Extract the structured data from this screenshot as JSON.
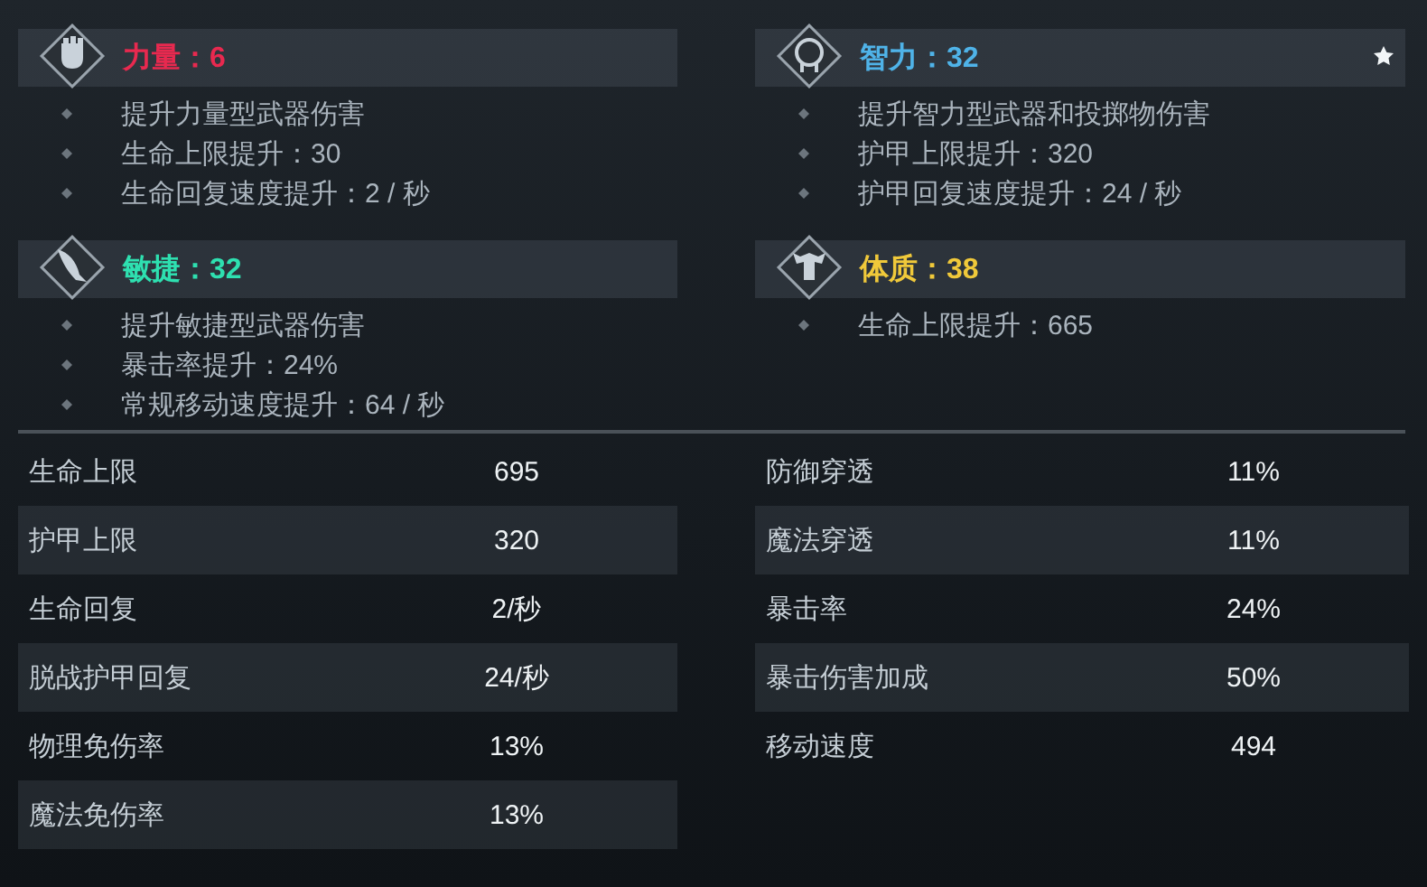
{
  "attributes": [
    {
      "kind": "strength",
      "name": "力量：",
      "value": "6",
      "color": "#e8294f",
      "starred": false,
      "effects": [
        "提升力量型武器伤害",
        "生命上限提升：30",
        "生命回复速度提升：2 / 秒"
      ]
    },
    {
      "kind": "intellect",
      "name": "智力：",
      "value": "32",
      "color": "#4fb3e8",
      "starred": true,
      "effects": [
        "提升智力型武器和投掷物伤害",
        "护甲上限提升：320",
        "护甲回复速度提升：24 / 秒"
      ]
    },
    {
      "kind": "agility",
      "name": "敏捷：",
      "value": "32",
      "color": "#2ee0b0",
      "starred": false,
      "effects": [
        "提升敏捷型武器伤害",
        "暴击率提升：24%",
        "常规移动速度提升：64 / 秒"
      ]
    },
    {
      "kind": "constitution",
      "name": "体质：",
      "value": "38",
      "color": "#f0c93a",
      "starred": false,
      "effects": [
        "生命上限提升：665"
      ]
    }
  ],
  "stats": [
    [
      {
        "label": "生命上限",
        "value": "695"
      },
      {
        "label": "护甲上限",
        "value": "320"
      },
      {
        "label": "生命回复",
        "value": "2/秒"
      },
      {
        "label": "脱战护甲回复",
        "value": "24/秒"
      },
      {
        "label": "物理免伤率",
        "value": "13%"
      },
      {
        "label": "魔法免伤率",
        "value": "13%"
      }
    ],
    [
      {
        "label": "防御穿透",
        "value": "11%"
      },
      {
        "label": "魔法穿透",
        "value": "11%"
      },
      {
        "label": "暴击率",
        "value": "24%"
      },
      {
        "label": "暴击伤害加成",
        "value": "50%"
      },
      {
        "label": "移动速度",
        "value": "494"
      }
    ]
  ]
}
